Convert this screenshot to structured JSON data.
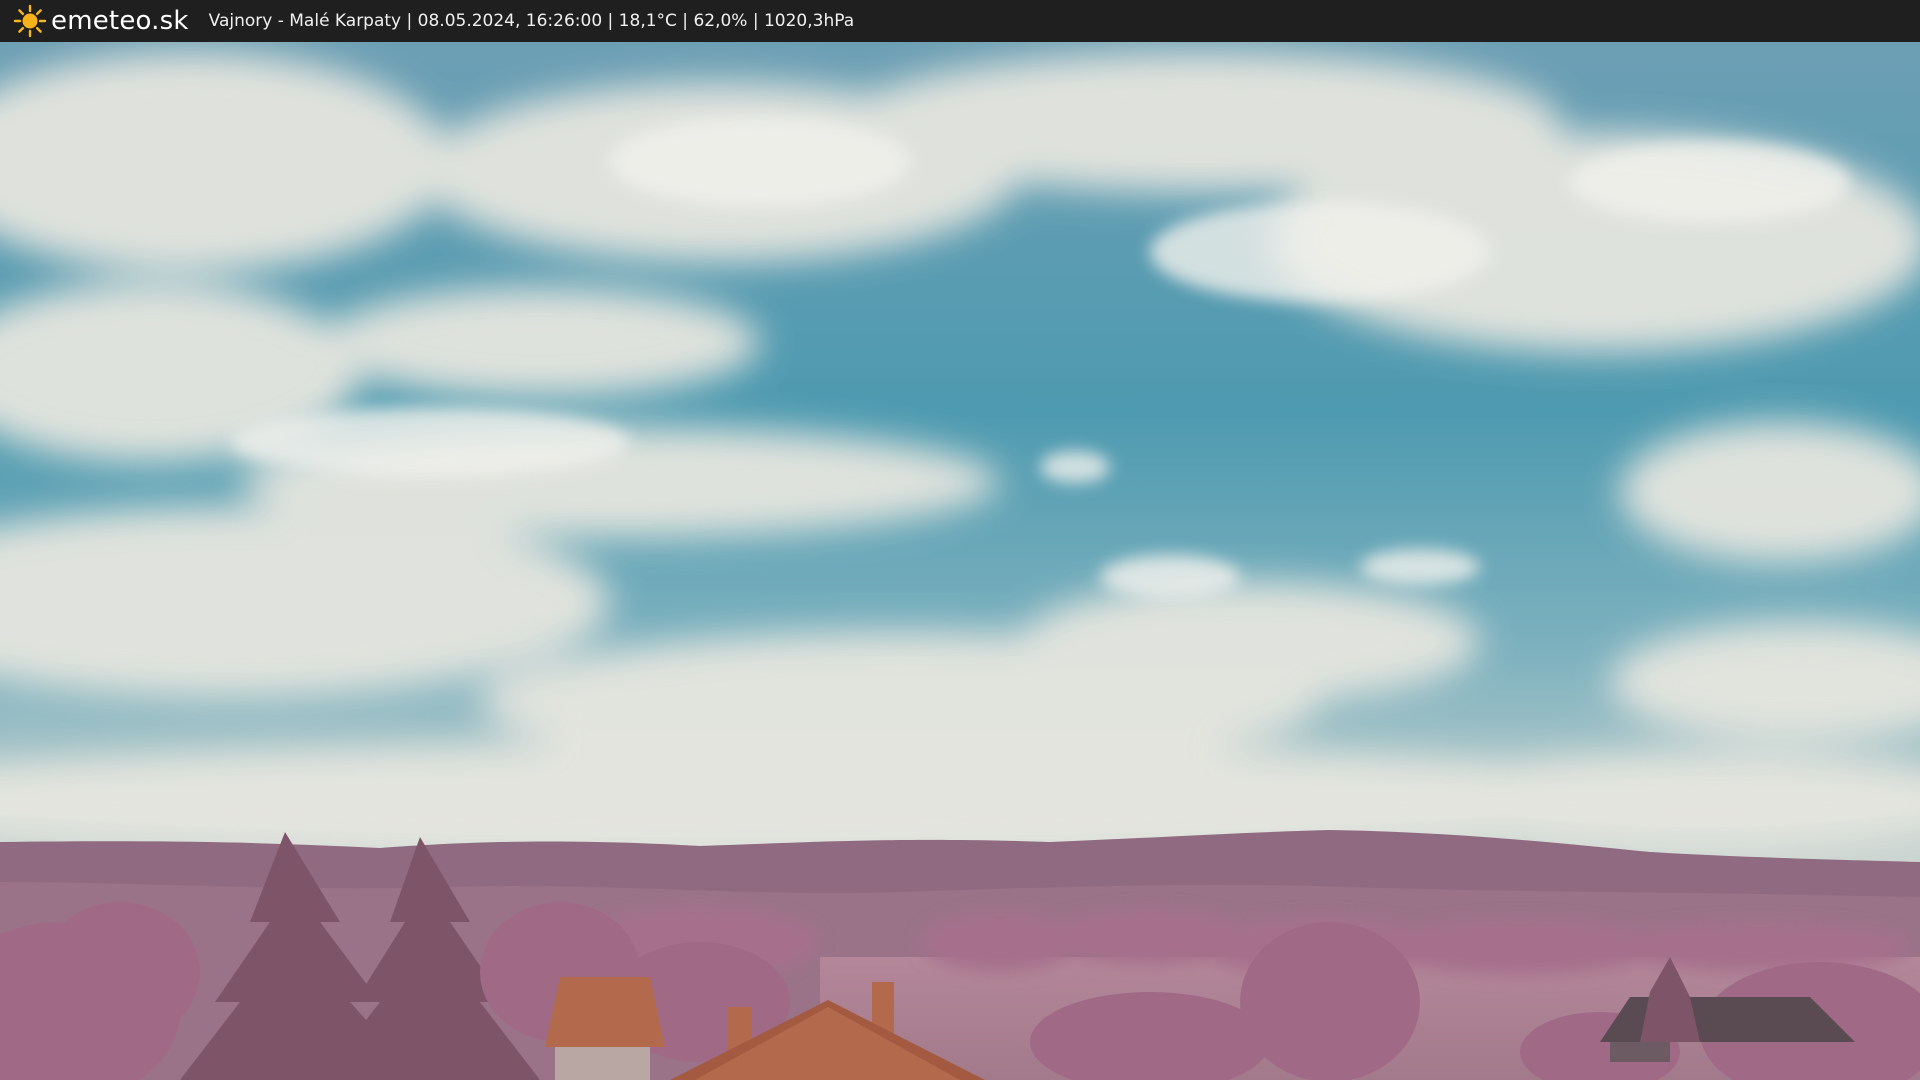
{
  "header": {
    "logo_icon": "sun-icon",
    "brand": "emeteo.sk",
    "info": "Vajnory - Malé Karpaty | 08.05.2024, 16:26:00 | 18,1°C | 62,0% | 1020,3hPa"
  },
  "colors": {
    "bar_background": "#1f1f1f",
    "sun": "#f5b81c",
    "sky": "#4e9ab0",
    "cloud": "#e8e8e2",
    "foliage": "#a86c8a"
  }
}
